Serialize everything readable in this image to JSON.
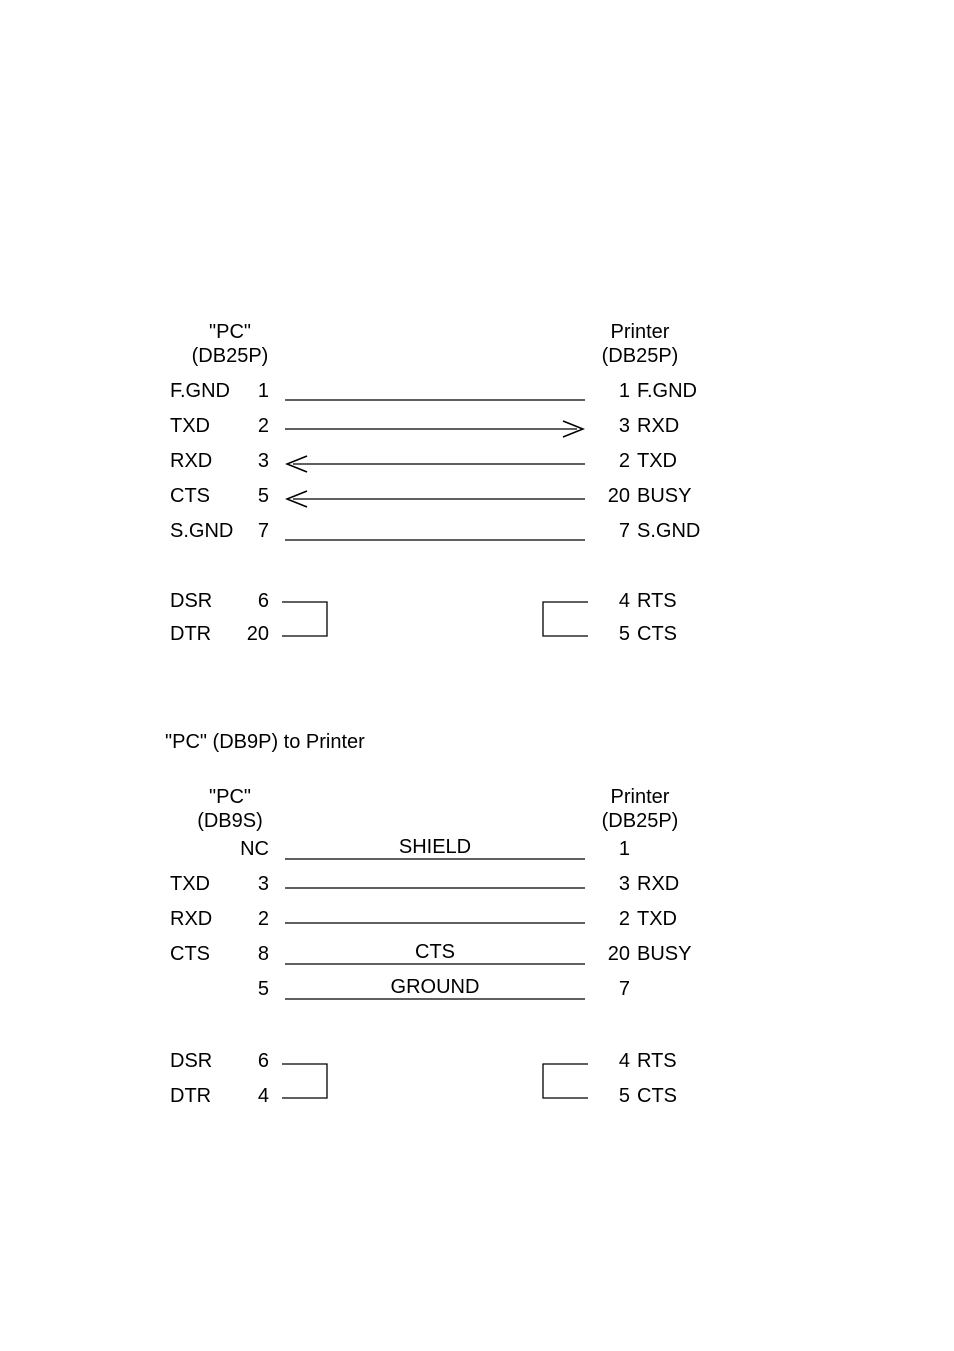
{
  "diagram1": {
    "left_header_line1": "\"PC\"",
    "left_header_line2": "(DB25P)",
    "right_header_line1": "Printer",
    "right_header_line2": "(DB25P)",
    "rows": [
      {
        "lname": "F.GND",
        "lpin": "1",
        "arrow": "none",
        "rname": "F.GND",
        "rpin": "1"
      },
      {
        "lname": "TXD",
        "lpin": "2",
        "arrow": "right",
        "rname": "RXD",
        "rpin": "3"
      },
      {
        "lname": "RXD",
        "lpin": "3",
        "arrow": "left",
        "rname": "TXD",
        "rpin": "2"
      },
      {
        "lname": "CTS",
        "lpin": "5",
        "arrow": "left",
        "rname": "BUSY",
        "rpin": "20"
      },
      {
        "lname": "S.GND",
        "lpin": "7",
        "arrow": "none",
        "rname": "S.GND",
        "rpin": "7"
      }
    ],
    "bridge_left": [
      {
        "name": "DSR",
        "pin": "6"
      },
      {
        "name": "DTR",
        "pin": "20"
      }
    ],
    "bridge_right": [
      {
        "pin": "4",
        "name": "RTS"
      },
      {
        "pin": "5",
        "name": "CTS"
      }
    ]
  },
  "subtitle": "\"PC\" (DB9P) to Printer",
  "diagram2": {
    "left_header_line1": "\"PC\"",
    "left_header_line2": "(DB9S)",
    "right_header_line1": "Printer",
    "right_header_line2": "(DB25P)",
    "rows": [
      {
        "lname": "",
        "lpin": "NC",
        "label": "SHIELD",
        "rname": "",
        "rpin": "1"
      },
      {
        "lname": "TXD",
        "lpin": "3",
        "label": "",
        "rname": "RXD",
        "rpin": "3"
      },
      {
        "lname": "RXD",
        "lpin": "2",
        "label": "",
        "rname": "TXD",
        "rpin": "2"
      },
      {
        "lname": "CTS",
        "lpin": "8",
        "label": "CTS",
        "rname": "BUSY",
        "rpin": "20"
      },
      {
        "lname": "",
        "lpin": "5",
        "label": "GROUND",
        "rname": "",
        "rpin": "7"
      }
    ],
    "bridge_left": [
      {
        "name": "DSR",
        "pin": "6"
      },
      {
        "name": "DTR",
        "pin": "4"
      }
    ],
    "bridge_right": [
      {
        "pin": "4",
        "name": "RTS"
      },
      {
        "pin": "5",
        "name": "CTS"
      }
    ]
  }
}
